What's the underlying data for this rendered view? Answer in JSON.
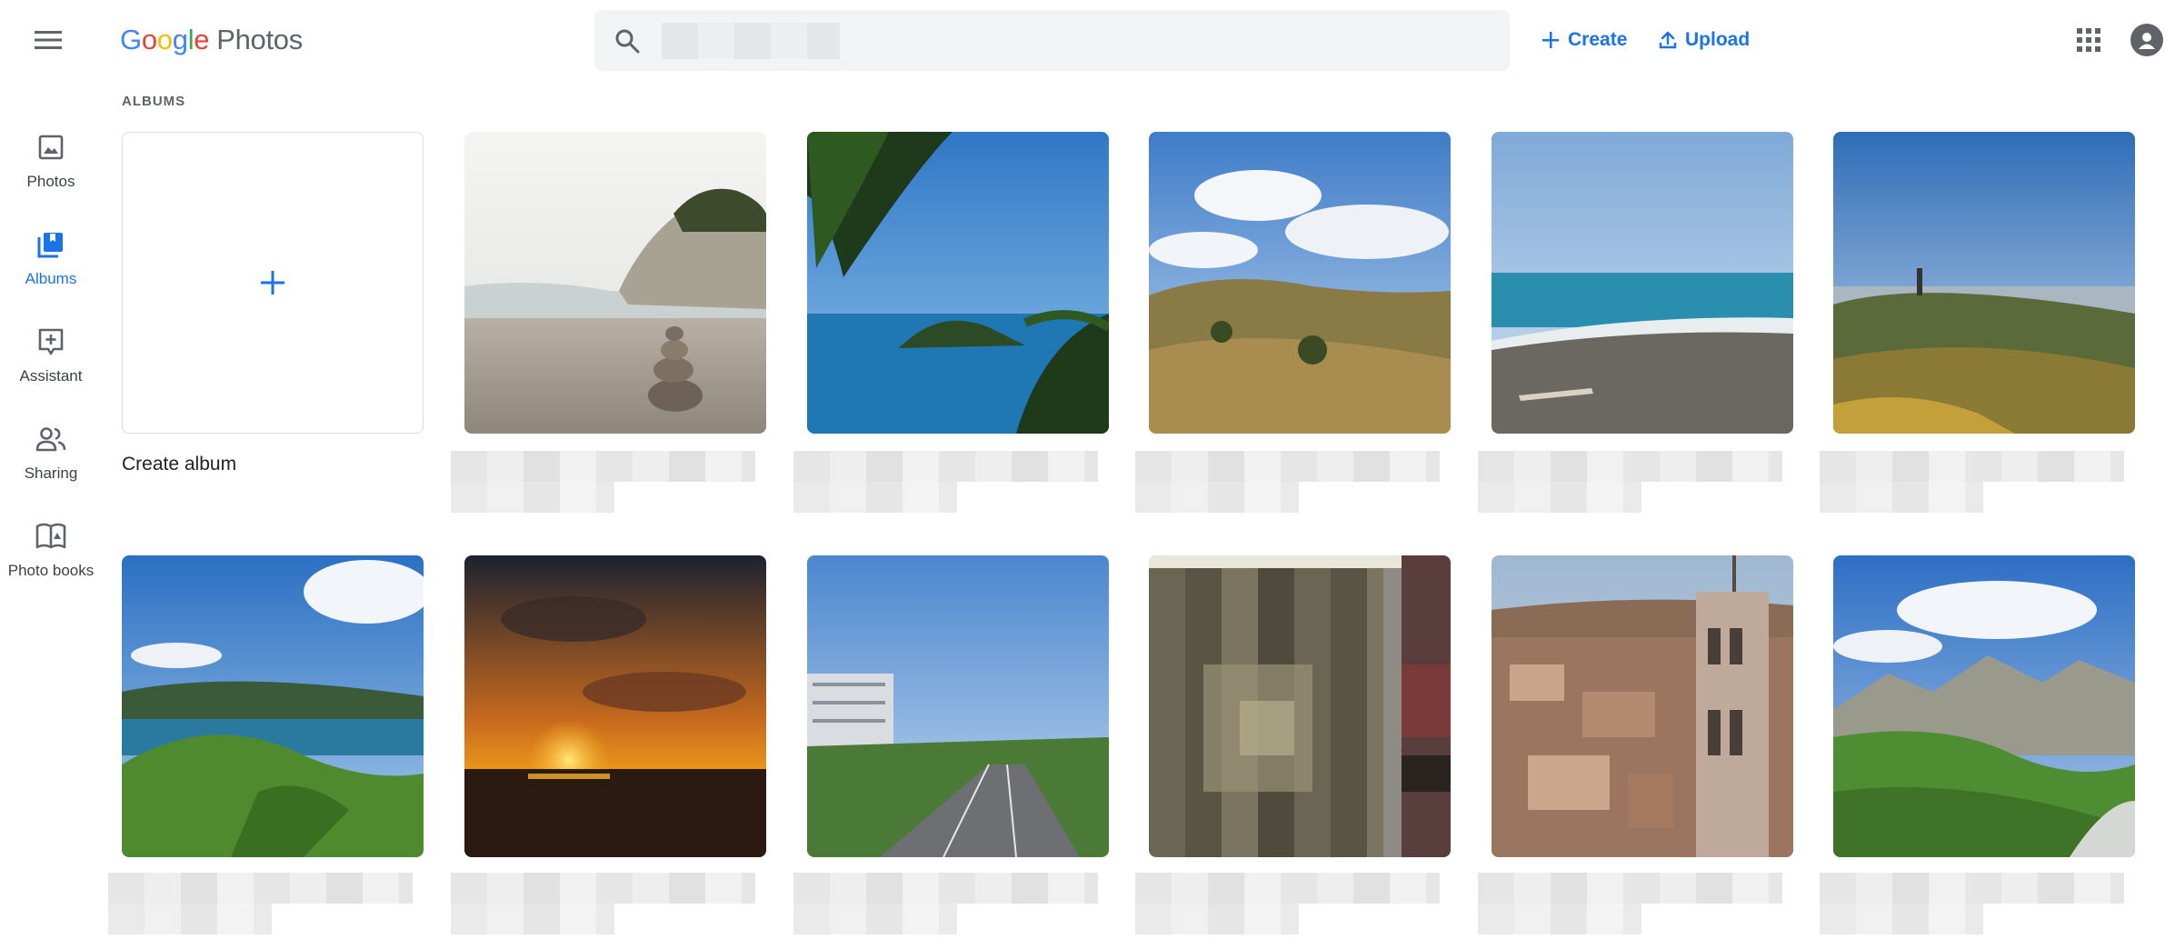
{
  "app": {
    "logo_brand": "Google",
    "logo_product": "Photos"
  },
  "header": {
    "search_placeholder": "",
    "create_label": "Create",
    "upload_label": "Upload",
    "icons": [
      "menu-icon",
      "search-icon",
      "plus-icon",
      "upload-icon",
      "apps-grid-icon",
      "account-icon"
    ]
  },
  "sidebar": {
    "items": [
      {
        "label": "Photos",
        "icon": "photo-icon",
        "active": false
      },
      {
        "label": "Albums",
        "icon": "album-icon",
        "active": true
      },
      {
        "label": "Assistant",
        "icon": "assistant-icon",
        "active": false
      },
      {
        "label": "Sharing",
        "icon": "people-icon",
        "active": false
      },
      {
        "label": "Photo books",
        "icon": "book-icon",
        "active": false
      }
    ]
  },
  "main": {
    "section_title": "ALBUMS",
    "create_album_label": "Create album",
    "albums": [
      {
        "thumbnail": "beach with stone cairn and rocky headland"
      },
      {
        "thumbnail": "ocean and small island framed by fern fronds"
      },
      {
        "thumbnail": "grassy rolling hills under cloudy sky"
      },
      {
        "thumbnail": "sea with dark sand beach and driftwood"
      },
      {
        "thumbnail": "coastal grass dunes with lighthouse"
      },
      {
        "thumbnail": "green hills overlooking bay and islands"
      },
      {
        "thumbnail": "sunset over the sea"
      },
      {
        "thumbnail": "motorway through city with tall building"
      },
      {
        "thumbnail": "pixelated image"
      },
      {
        "thumbnail": "aerial view of old city with tower"
      },
      {
        "thumbnail": "mountain valley with green slopes"
      }
    ]
  },
  "colors": {
    "accent": "#1a73e8",
    "icon_gray": "#5f6368",
    "search_bg": "#f1f3f4"
  }
}
